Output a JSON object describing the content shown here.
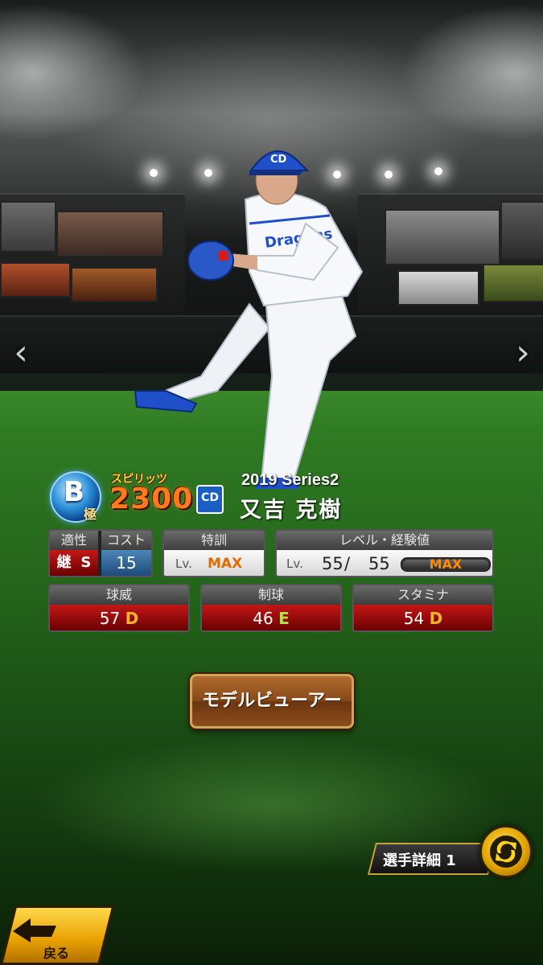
{
  "header": {
    "series": "2019 Series2",
    "player_name": "又吉 克樹",
    "rank_letter": "B",
    "rank_kanji": "極",
    "spirits_label": "スピリッツ",
    "spirits_value": "2300",
    "team_logo_text": "CD"
  },
  "stats_top": {
    "aptitude_label": "適性",
    "aptitude_role": "継",
    "aptitude_grade": "S",
    "cost_label": "コスト",
    "cost_value": "15",
    "training_label": "特訓",
    "training_lv": "Lv.",
    "training_value": "MAX",
    "level_label": "レベル・経験値",
    "level_lv": "Lv.",
    "level_current": "55",
    "level_sep": "/",
    "level_max": "55",
    "exp_value": "MAX"
  },
  "abilities": [
    {
      "label": "球威",
      "value": "57",
      "grade": "D"
    },
    {
      "label": "制球",
      "value": "46",
      "grade": "E"
    },
    {
      "label": "スタミナ",
      "value": "54",
      "grade": "D"
    }
  ],
  "buttons": {
    "model_viewer": "モデルビューアー",
    "player_detail": "選手詳細 1",
    "back": "戻る"
  },
  "icons": [
    "chevron-left-icon",
    "chevron-right-icon",
    "swap-icon",
    "back-arrow-icon"
  ],
  "colors": {
    "grade_d": "#f4b429",
    "grade_e": "#b6e04b",
    "spirits": "#ff7a1a",
    "max": "#e36a00"
  }
}
